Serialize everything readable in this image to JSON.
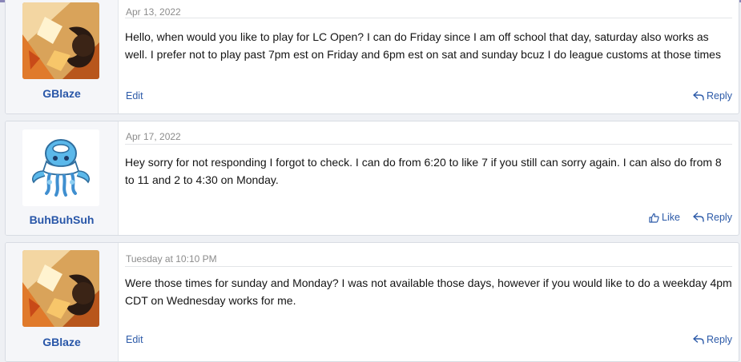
{
  "posts": [
    {
      "username": "GBlaze",
      "date": "Apr 13, 2022",
      "body": "Hello, when would you like to play for LC Open? I can do Friday since I am off school that day, saturday also works as well. I prefer not to play past 7pm est on Friday and 6pm est on sat and sunday bcuz I do league customs at those times",
      "edit_label": "Edit",
      "reply_label": "Reply"
    },
    {
      "username": "BuhBuhSuh",
      "date": "Apr 17, 2022",
      "body": "Hey sorry for not responding I forgot to check. I can do from 6:20 to like 7 if you still can sorry again. I can also do from 8 to 11 and 2 to 4:30 on Monday.",
      "like_label": "Like",
      "reply_label": "Reply"
    },
    {
      "username": "GBlaze",
      "date": "Tuesday at 10:10 PM",
      "body": "Were those times for sunday and Monday? I was not available those days, however if you would like to do a weekday 4pm CDT on Wednesday works for me.",
      "edit_label": "Edit",
      "reply_label": "Reply"
    }
  ],
  "colors": {
    "link": "#2c5aa8",
    "username": "#2856a8",
    "user_column_bg": "#f5f6f9",
    "page_bg": "#eef0f4"
  },
  "icons": {
    "reply": "reply-arrow-icon",
    "like": "thumbs-up-icon"
  }
}
